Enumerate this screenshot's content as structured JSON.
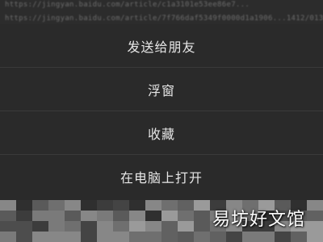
{
  "background": {
    "links": [
      "https://jingyan.baidu.com/article/c1a3101e53ee86e7...",
      "https://jingyan.baidu.com/article/7f766daf5349f0000d1a1906...1412/0131 1"
    ]
  },
  "action_sheet": {
    "items": [
      {
        "label": "发送给朋友"
      },
      {
        "label": "浮窗"
      },
      {
        "label": "收藏"
      },
      {
        "label": "在电脑上打开"
      }
    ]
  },
  "watermark": {
    "text": "易坊好文馆"
  },
  "colors": {
    "sheet_background": "#2a2a2a",
    "item_text": "#e6e6e6",
    "divider": "#3a3a3a"
  }
}
